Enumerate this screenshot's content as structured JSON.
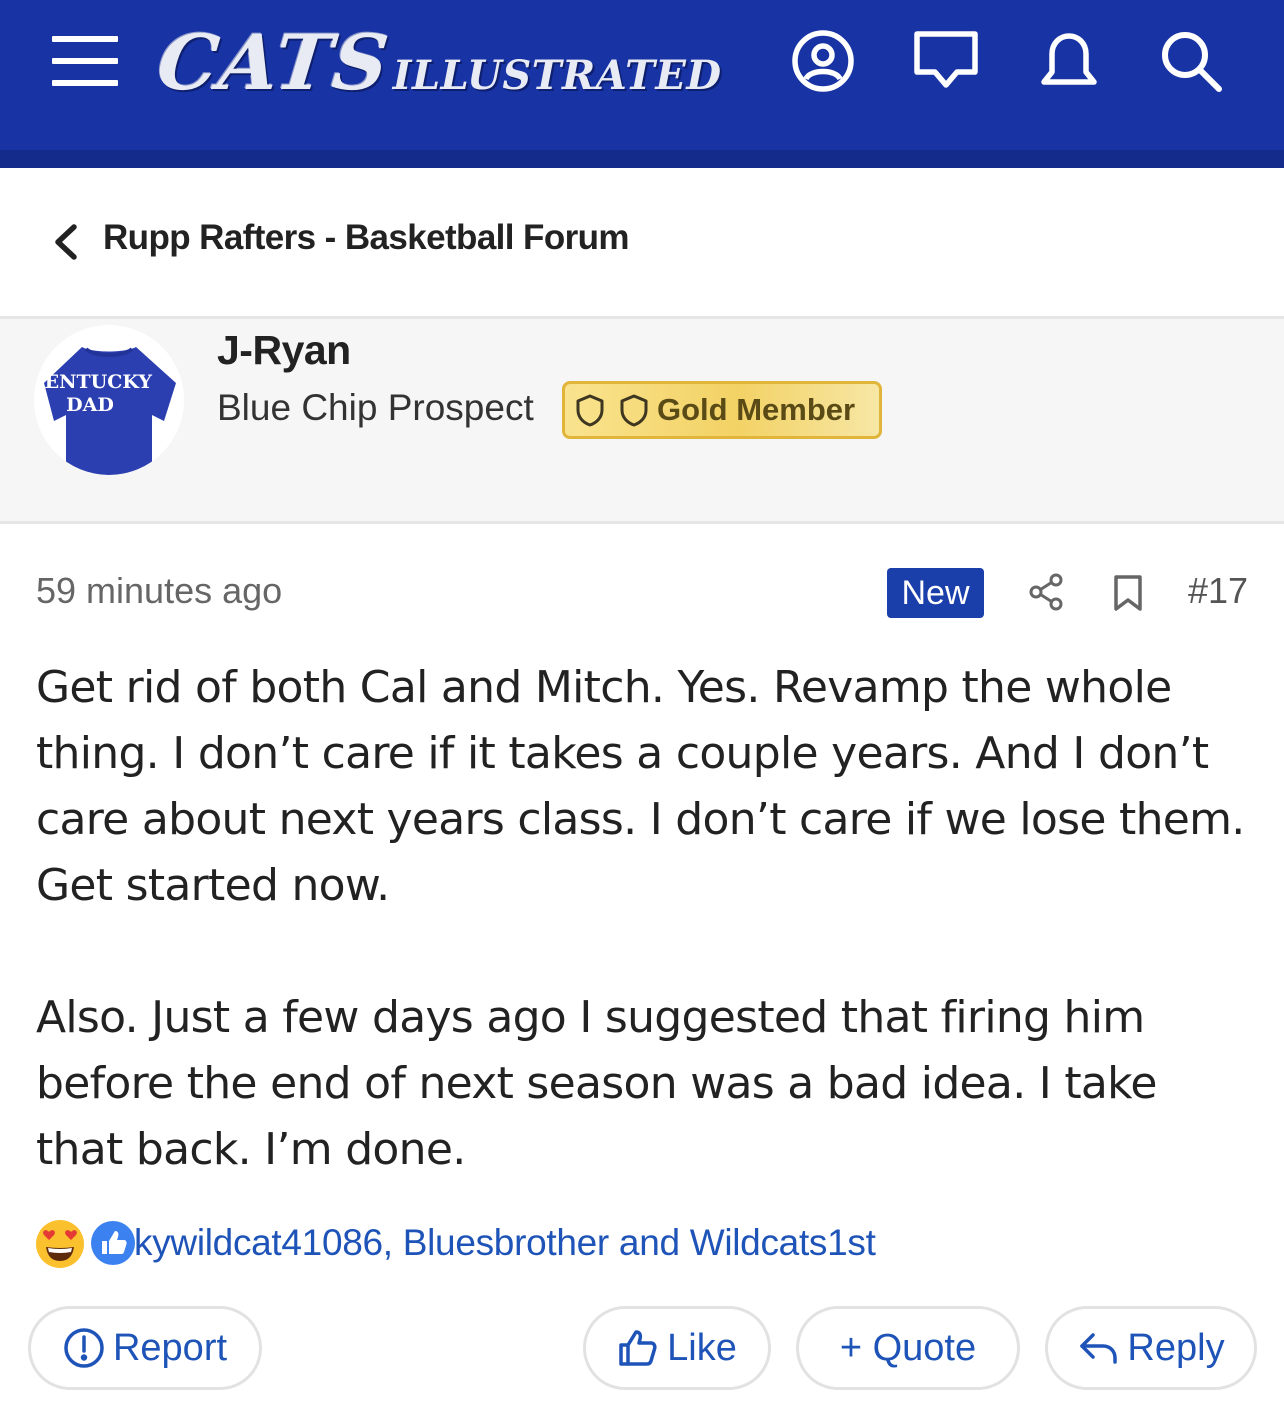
{
  "header": {
    "logo_main": "CATS",
    "logo_sub": "ILLUSTRATED",
    "icons": [
      "menu-icon",
      "account-icon",
      "conversations-icon",
      "alerts-icon",
      "search-icon"
    ],
    "brand_color": "#1833a4"
  },
  "breadcrumb": {
    "label": "Rupp Rafters - Basketball Forum"
  },
  "user": {
    "name": "J-Ryan",
    "title": "Blue Chip Prospect",
    "badge": "Gold Member",
    "avatar_text_line1": "KENTUCKY",
    "avatar_text_line2": "DAD"
  },
  "post": {
    "time": "59 minutes ago",
    "new_label": "New",
    "number": "#17",
    "paragraphs": [
      "Get rid of both Cal and Mitch. Yes. Revamp the whole thing. I don’t care if it takes a couple years. And I don’t care about next years class. I don’t care if we lose them. Get started now.",
      "Also. Just a few days ago I suggested that firing him before the end of next season was a bad idea. I take that back. I’m done."
    ]
  },
  "reactions": {
    "icons": [
      "heart-eyes-emoji-icon",
      "like-reaction-icon"
    ],
    "names": "kywildcat41086, Bluesbrother and Wildcats1st"
  },
  "actions": {
    "report": "Report",
    "like": "Like",
    "quote": "+ Quote",
    "reply": "Reply"
  },
  "colors": {
    "link": "#1e53b8",
    "new_badge": "#1a3eaa",
    "gold_badge": "#f3d265"
  }
}
